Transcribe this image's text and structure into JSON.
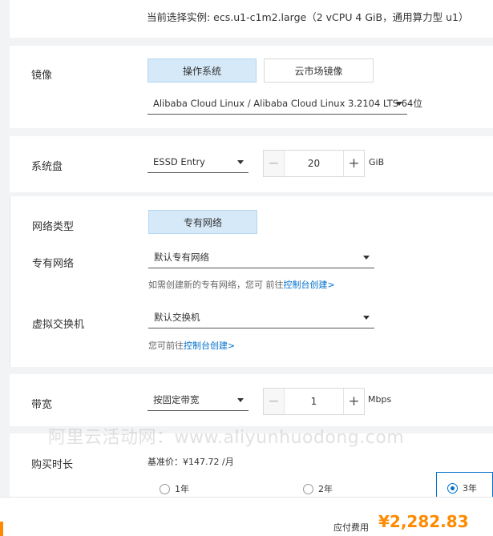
{
  "instance": {
    "selection_text": "当前选择实例: ecs.u1-c1m2.large（2 vCPU 4 GiB，通用算力型 u1）"
  },
  "image": {
    "label": "镜像",
    "tabs": [
      {
        "label": "操作系统",
        "selected": true
      },
      {
        "label": "云市场镜像",
        "selected": false
      }
    ],
    "os_value": "Alibaba Cloud Linux / Alibaba Cloud Linux 3.2104 LTS 64位"
  },
  "system_disk": {
    "label": "系统盘",
    "type_value": "ESSD Entry",
    "size_value": "20",
    "unit": "GiB"
  },
  "network": {
    "type_label": "网络类型",
    "type_button": "专有网络",
    "vpc_label": "专有网络",
    "vpc_value": "默认专有网络",
    "vpc_hint_prefix": "如需创建新的专有网络，您可 前往",
    "vpc_hint_link": "控制台创建>",
    "vswitch_label": "虚拟交换机",
    "vswitch_value": "默认交换机",
    "vswitch_hint_prefix": "您可前往",
    "vswitch_hint_link": "控制台创建>"
  },
  "bandwidth": {
    "label": "带宽",
    "billing_value": "按固定带宽",
    "size_value": "1",
    "unit": "Mbps"
  },
  "watermark": "阿里云活动网：www.aliyunhuodong.com",
  "duration": {
    "label": "购买时长",
    "base_price": "基准价：¥147.72 /月",
    "options": [
      {
        "label": "1年",
        "checked": false
      },
      {
        "label": "2年",
        "checked": false
      },
      {
        "label": "3年",
        "checked": true
      }
    ]
  },
  "footer": {
    "fee_label": "应付费用",
    "fee_value": "¥2,282.83"
  },
  "colors": {
    "accent": "#0070cc",
    "price": "#ff8a00",
    "selected_bg": "#d6e9f8",
    "footer_bar": "#ff8a00"
  }
}
